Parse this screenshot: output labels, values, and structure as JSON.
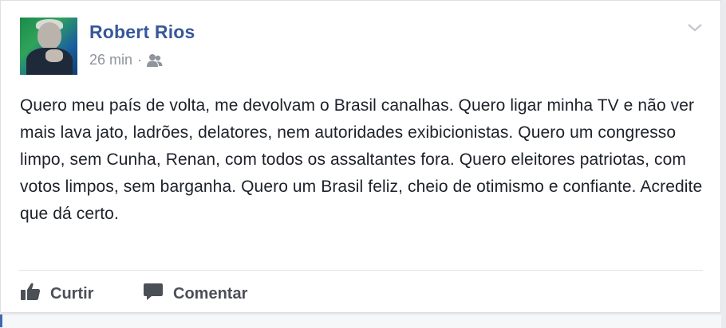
{
  "post": {
    "author": "Robert Rios",
    "timestamp": "26 min",
    "separator": "·",
    "audience_icon": "friends-icon",
    "menu_icon": "chevron-down-icon",
    "text": "Quero meu país de volta, me devolvam o Brasil canalhas. Quero ligar minha TV e não ver mais lava jato, ladrões, delatores, nem autoridades exibicionistas. Quero um congresso limpo, sem Cunha, Renan, com todos os assaltantes fora. Quero eleitores patriotas, com votos limpos, sem barganha. Quero um Brasil feliz, cheio de otimismo e confiante. Acredite que dá certo."
  },
  "actions": {
    "like_label": "Curtir",
    "like_icon": "thumbs-up-icon",
    "comment_label": "Comentar",
    "comment_icon": "speech-bubble-icon"
  },
  "colors": {
    "author_link": "#365899",
    "meta_text": "#90949c",
    "body_text": "#1d2129",
    "action_text": "#4b4f56"
  }
}
